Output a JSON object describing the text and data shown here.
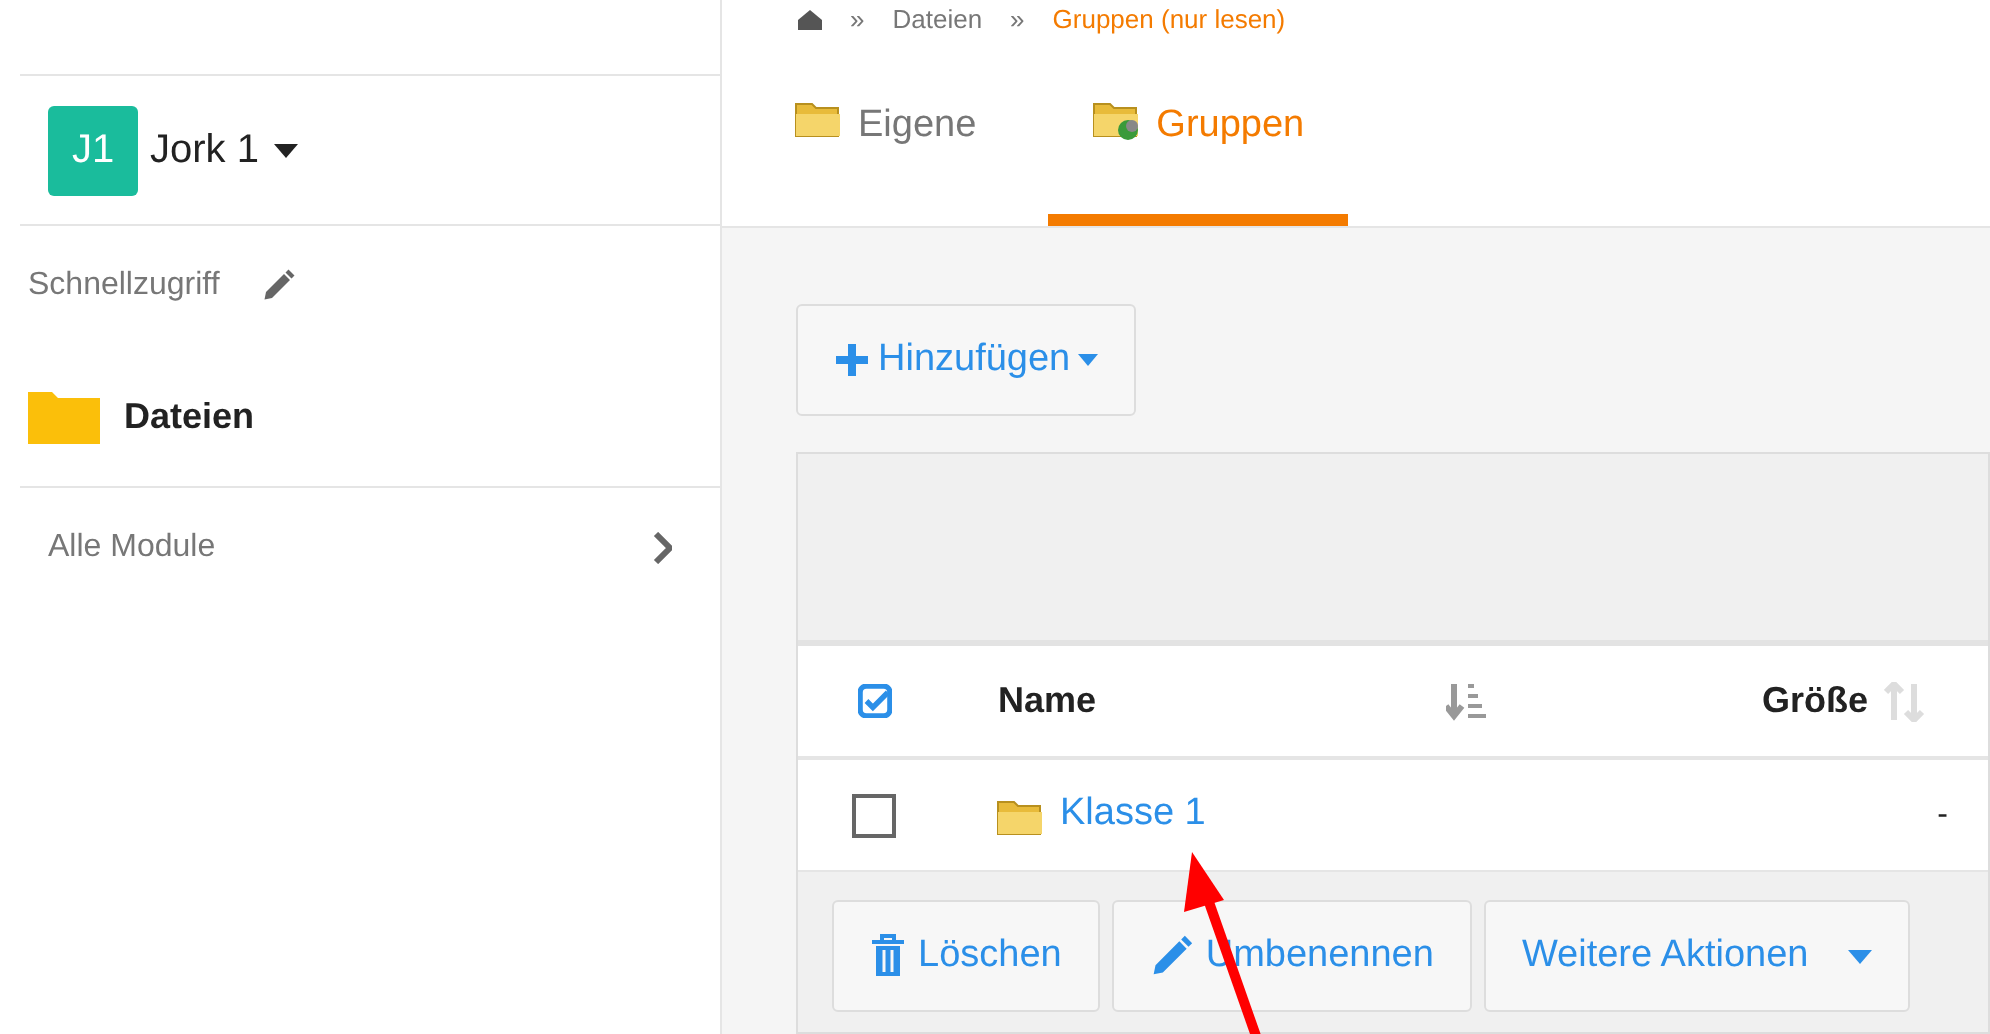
{
  "sidebar": {
    "account": {
      "initials": "J1",
      "name": "Jork 1"
    },
    "quick_access": {
      "label": "Schnellzugriff"
    },
    "items": [
      {
        "label": "Dateien",
        "selected": true
      }
    ],
    "modules": {
      "label": "Alle Module"
    }
  },
  "breadcrumb": {
    "separator": "»",
    "items": [
      "Dateien",
      "Gruppen (nur lesen)"
    ]
  },
  "tabs": [
    {
      "label": "Eigene",
      "selected": false,
      "kind": "own"
    },
    {
      "label": "Gruppen",
      "selected": true,
      "kind": "group"
    }
  ],
  "add_button": {
    "label": "Hinzufügen"
  },
  "table": {
    "columns": [
      "Name",
      "Größe"
    ],
    "rows": [
      {
        "name": "Klasse 1",
        "size": "-",
        "checked": false
      }
    ]
  },
  "actions": [
    {
      "label": "Löschen",
      "kind": "delete"
    },
    {
      "label": "Umbenennen",
      "kind": "rename"
    },
    {
      "label": "Weitere Aktionen",
      "kind": "more"
    }
  ]
}
